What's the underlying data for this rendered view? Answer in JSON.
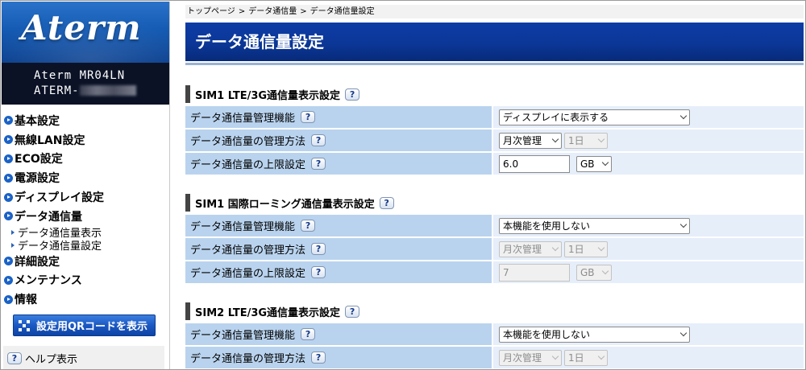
{
  "sidebar": {
    "logo": "Aterm",
    "model": "Aterm MR04LN",
    "device_id_prefix": "ATERM-",
    "menu": [
      {
        "label": "基本設定"
      },
      {
        "label": "無線LAN設定"
      },
      {
        "label": "ECO設定"
      },
      {
        "label": "電源設定"
      },
      {
        "label": "ディスプレイ設定"
      },
      {
        "label": "データ通信量"
      },
      {
        "label": "詳細設定"
      },
      {
        "label": "メンテナンス"
      },
      {
        "label": "情報"
      }
    ],
    "submenu": [
      {
        "label": "データ通信量表示"
      },
      {
        "label": "データ通信量設定"
      }
    ],
    "qr_button": "設定用QRコードを表示",
    "help": "ヘルプ表示"
  },
  "breadcrumb": {
    "items": [
      "トップページ",
      "データ通信量",
      "データ通信量設定"
    ],
    "separator": ">"
  },
  "page_title": "データ通信量設定",
  "help_mark": "?",
  "sections": [
    {
      "title": "SIM1 LTE/3G通信量表示設定",
      "rows": [
        {
          "label": "データ通信量管理機能",
          "value": "ディスプレイに表示する"
        },
        {
          "label": "データ通信量の管理方法",
          "period": "月次管理",
          "day": "1日"
        },
        {
          "label": "データ通信量の上限設定",
          "limit": "6.0",
          "unit": "GB"
        }
      ]
    },
    {
      "title": "SIM1 国際ローミング通信量表示設定",
      "rows": [
        {
          "label": "データ通信量管理機能",
          "value": "本機能を使用しない"
        },
        {
          "label": "データ通信量の管理方法",
          "period": "月次管理",
          "day": "1日"
        },
        {
          "label": "データ通信量の上限設定",
          "limit": "7",
          "unit": "GB"
        }
      ]
    },
    {
      "title": "SIM2 LTE/3G通信量表示設定",
      "rows": [
        {
          "label": "データ通信量管理機能",
          "value": "本機能を使用しない"
        },
        {
          "label": "データ通信量の管理方法",
          "period": "月次管理",
          "day": "1日"
        }
      ]
    }
  ]
}
